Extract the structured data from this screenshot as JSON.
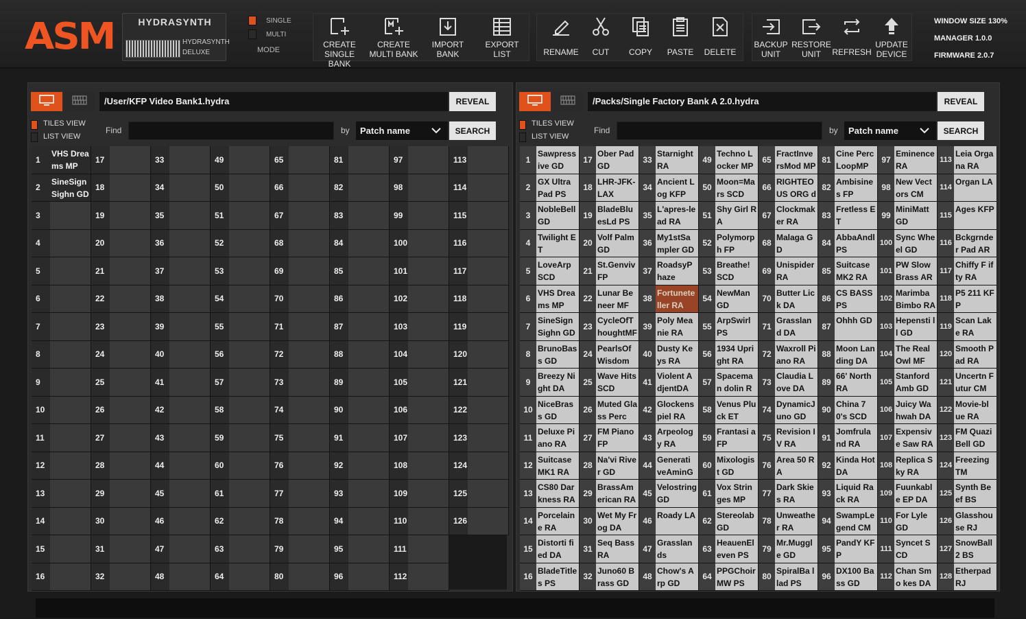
{
  "toolbar": {
    "logo": "ASM",
    "product": {
      "name": "HYDRASYNTH",
      "sub1": "HYDRASYNTH",
      "sub2": "DELUXE"
    },
    "mode": {
      "label": "MODE",
      "options": [
        "SINGLE",
        "MULTI"
      ],
      "selected": "SINGLE"
    },
    "buttons": [
      {
        "label": "CREATE\nSINGLE BANK",
        "icon": "create-single-bank-icon"
      },
      {
        "label": "CREATE\nMULTI BANK",
        "icon": "create-multi-bank-icon"
      },
      {
        "label": "IMPORT\nBANK",
        "icon": "import-bank-icon"
      },
      {
        "label": "EXPORT\nLIST",
        "icon": "export-list-icon"
      },
      {
        "label": "RENAME",
        "icon": "pencil-icon"
      },
      {
        "label": "CUT",
        "icon": "scissors-icon"
      },
      {
        "label": "COPY",
        "icon": "copy-icon"
      },
      {
        "label": "PASTE",
        "icon": "clipboard-icon"
      },
      {
        "label": "DELETE",
        "icon": "delete-icon"
      },
      {
        "label": "BACKUP\nUNIT",
        "icon": "backup-icon"
      },
      {
        "label": "RESTORE\nUNIT",
        "icon": "restore-icon"
      },
      {
        "label": "REFRESH",
        "icon": "refresh-icon"
      },
      {
        "label": "UPDATE\nDEVICE",
        "icon": "upload-arrow-icon"
      }
    ],
    "info": [
      "WINDOW SIZE 130%",
      "MANAGER 1.0.0",
      "FIRMWARE 2.0.7"
    ]
  },
  "left": {
    "path": "/User/KFP Video Bank1.hydra",
    "reveal": "REVEAL",
    "views": [
      "TILES VIEW",
      "LIST VIEW"
    ],
    "active_view": "TILES VIEW",
    "find_label": "Find",
    "find_value": "",
    "by_label": "by",
    "by_value": "Patch name",
    "search": "SEARCH",
    "patches": [
      "VHS Dreams MP",
      "SineSign Sighn GD",
      "",
      "",
      "",
      "",
      "",
      "",
      "",
      "",
      "",
      "",
      "",
      "",
      "",
      "",
      "",
      "",
      "",
      "",
      "",
      "",
      "",
      "",
      "",
      "",
      "",
      "",
      "",
      "",
      "",
      "",
      "",
      "",
      "",
      "",
      "",
      "",
      "",
      "",
      "",
      "",
      "",
      "",
      "",
      "",
      "",
      "",
      "",
      "",
      "",
      "",
      "",
      "",
      "",
      "",
      "",
      "",
      "",
      "",
      "",
      "",
      "",
      "",
      "",
      "",
      "",
      "",
      "",
      "",
      "",
      "",
      "",
      "",
      "",
      "",
      "",
      "",
      "",
      "",
      "",
      "",
      "",
      "",
      "",
      "",
      "",
      "",
      "",
      "",
      "",
      "",
      "",
      "",
      "",
      "",
      "",
      "",
      "",
      "",
      "",
      "",
      "",
      "",
      "",
      "",
      "",
      "",
      "",
      "",
      "",
      "",
      "",
      "",
      "",
      "",
      "",
      "",
      "",
      "",
      "",
      "",
      "",
      "",
      "",
      ""
    ]
  },
  "right": {
    "path": "/Packs/Single Factory Bank A 2.0.hydra",
    "reveal": "REVEAL",
    "views": [
      "TILES VIEW",
      "LIST VIEW"
    ],
    "active_view": "TILES VIEW",
    "find_label": "Find",
    "find_value": "",
    "by_label": "by",
    "by_value": "Patch name",
    "search": "SEARCH",
    "highlighted": 38,
    "patches": [
      "Sawpressive GD",
      "GX Ultra Pad PS",
      "NobleBell GD",
      "Twilight ET",
      "LoveArp SCD",
      "VHS Dreams MP",
      "SineSign Sighn GD",
      "BrunoBass GD",
      "Breezy Night DA",
      "NiceBrass GD",
      "Deluxe Piano RA",
      "Suitcase MK1 RA",
      "CS80 Darkness RA",
      "Porcelaine RA",
      "Distorti fied DA",
      "BladeTitles PS",
      "Ober Pad GD",
      "LHR-JFK-LAX",
      "BladeBluesLd PS",
      "Volf Palm GD",
      "St.Genviv FP",
      "Lunar Be neer MF",
      "CycleOfThoughtMF",
      "PearlsOf Wisdom",
      "Wave Hits SCD",
      "Muted Glass Perc",
      "FM Piano FP",
      "Na'vi River GD",
      "BrassAmerican RA",
      "Wet My Frog DA",
      "Seq Bass RA",
      "Juno60 Brass GD",
      "Starnight RA",
      "Ancient Log KFP",
      "L'apres-lead RA",
      "My1stSampler GD",
      "RoadsyPhaze",
      "Fortuneteller RA",
      "Poly Meanie RA",
      "Dusty Keys RA",
      "Violent AdjentDA",
      "Glockenspiel RA",
      "Arpeology RA",
      "Generati veAminGD",
      "Velostring GD",
      "Roady LA",
      "Grasslands",
      "Chow's Arp GD",
      "Techno Locker MP",
      "Moon=Mars SCD",
      "Shy Girl RA",
      "Polymorph FP",
      "Breathe! SCD",
      "NewMan GD",
      "ArpSwirl PS",
      "1934 Upright RA",
      "Spaceman dolin RA",
      "Venus Pluck ET",
      "Frantasi a FP",
      "Mixologist GD",
      "Vox Stringes MP",
      "Stereolab GD",
      "HeauenEleven PS",
      "PPGChoir MW PS",
      "FractInversMod MP",
      "RIGHTEOUS ORG df",
      "Clockmaker RA",
      "Malaga GD",
      "Unispider RA",
      "Butter Lick DA",
      "Grasslan d DA",
      "Waxroll Piano RA",
      "Claudia Love DA",
      "DynamicJuno GD",
      "Revision IV RA",
      "Area 50 RA",
      "Dark Skies RA",
      "Unweather RA",
      "Mr.Muggle GD",
      "SpiralBa llad PS",
      "Cine Perc LoopMP",
      "Ambisine s FP",
      "Fretless ET",
      "AbbaAndl PS",
      "Suitcase MK2 RA",
      "CS BASS PS",
      "Ohhh GD",
      "Moon Landing DA",
      "66' North RA",
      "China 70's SCD",
      "Jomfrula nd RA",
      "Kinda Hot DA",
      "Liquid Rack RA",
      "SwampLegend CM",
      "PandY KFP",
      "DX100 Bass GD",
      "Eminence RA",
      "New Vectors CM",
      "MiniMatt GD",
      "Sync Wheel GD",
      "PW Slow Brass AR",
      "Marimba Bimbo RA",
      "Hepensti ll GD",
      "The Real Owl MF",
      "Stanford Amb GD",
      "Juicy Wa hwah DA",
      "Expensiv e Saw RA",
      "Replica Sky RA",
      "Fuunkabl e EP DA",
      "For Lyle GD",
      "Syncet SCD",
      "Chan Smo kes DA",
      "Leia Organa RA",
      "Organ LA",
      "Ages KFP",
      "Bckgrnde r Pad AR",
      "Chiffy F ifty RA",
      "P5 211 KFP",
      "Scan Lake RA",
      "Smooth P ad RA",
      "Uncertn Futur CM",
      "Movie-bl ue RA",
      "FM Quazi Bell GD",
      "Freezing TM",
      "Synth Beef BS",
      "Glasshou se RJ",
      "SnowBall 2 BS",
      "Etherpad RJ"
    ]
  }
}
